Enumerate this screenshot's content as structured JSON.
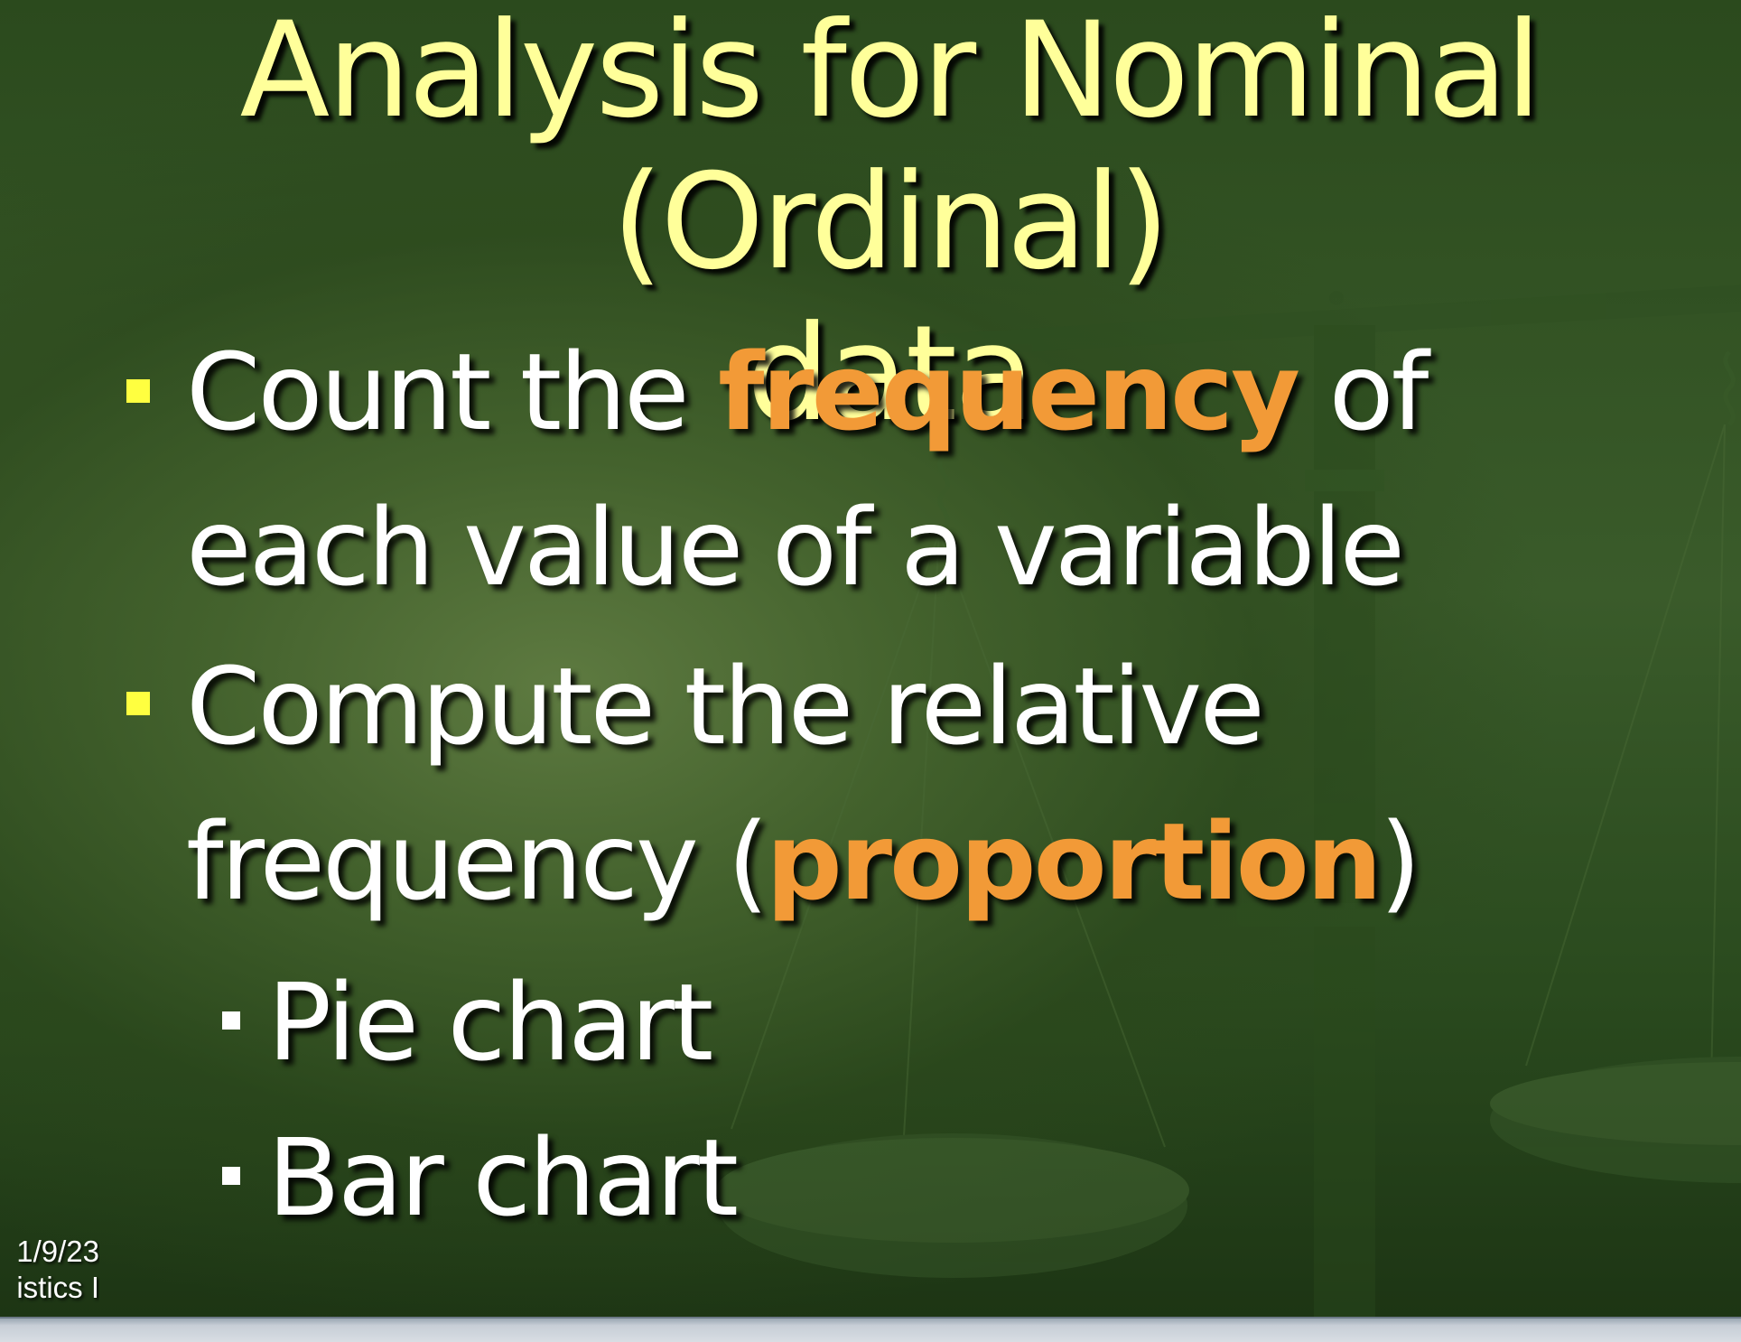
{
  "slide": {
    "title_line1": "Analysis for Nominal (Ordinal)",
    "title_line2": "data",
    "bullets": [
      {
        "text_before": "Count the ",
        "highlight": "frequency",
        "text_after_line1": " of",
        "line2": "each value of a variable"
      },
      {
        "line1": "Compute the relative",
        "text_before_line2": "frequency (",
        "highlight": "proportion",
        "text_after": ")"
      }
    ],
    "sub_bullets": [
      "Pie chart",
      "Bar chart"
    ],
    "footer": {
      "date": "1/9/23",
      "course": "istics I"
    }
  },
  "colors": {
    "title": "#ffff9a",
    "highlight": "#f29a37",
    "bullet_marker": "#ffff40",
    "sub_bullet_marker": "#ffffff",
    "background": "#2f4d22"
  },
  "icons": {
    "background_image": "balance-scale-icon"
  }
}
